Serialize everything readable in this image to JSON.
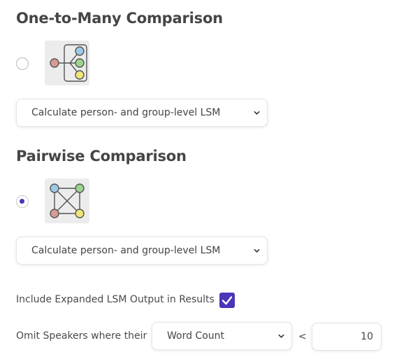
{
  "sections": {
    "one_to_many": {
      "title": "One-to-Many Comparison",
      "selected": false,
      "diagram_icon": "one-to-many-diagram-icon",
      "select_value": "Calculate person- and group-level LSM"
    },
    "pairwise": {
      "title": "Pairwise Comparison",
      "selected": true,
      "diagram_icon": "pairwise-diagram-icon",
      "select_value": "Calculate person- and group-level LSM"
    }
  },
  "options": {
    "expanded_output_label": "Include Expanded LSM Output in Results",
    "expanded_output_checked": true,
    "omit_label": "Omit Speakers where their",
    "omit_metric": "Word Count",
    "omit_operator": "<",
    "omit_threshold": "10"
  },
  "colors": {
    "accent": "#4936b8",
    "node_red": "#d89a93",
    "node_blue": "#9ccbe6",
    "node_green": "#9dd48e",
    "node_yellow": "#f0e47a"
  }
}
